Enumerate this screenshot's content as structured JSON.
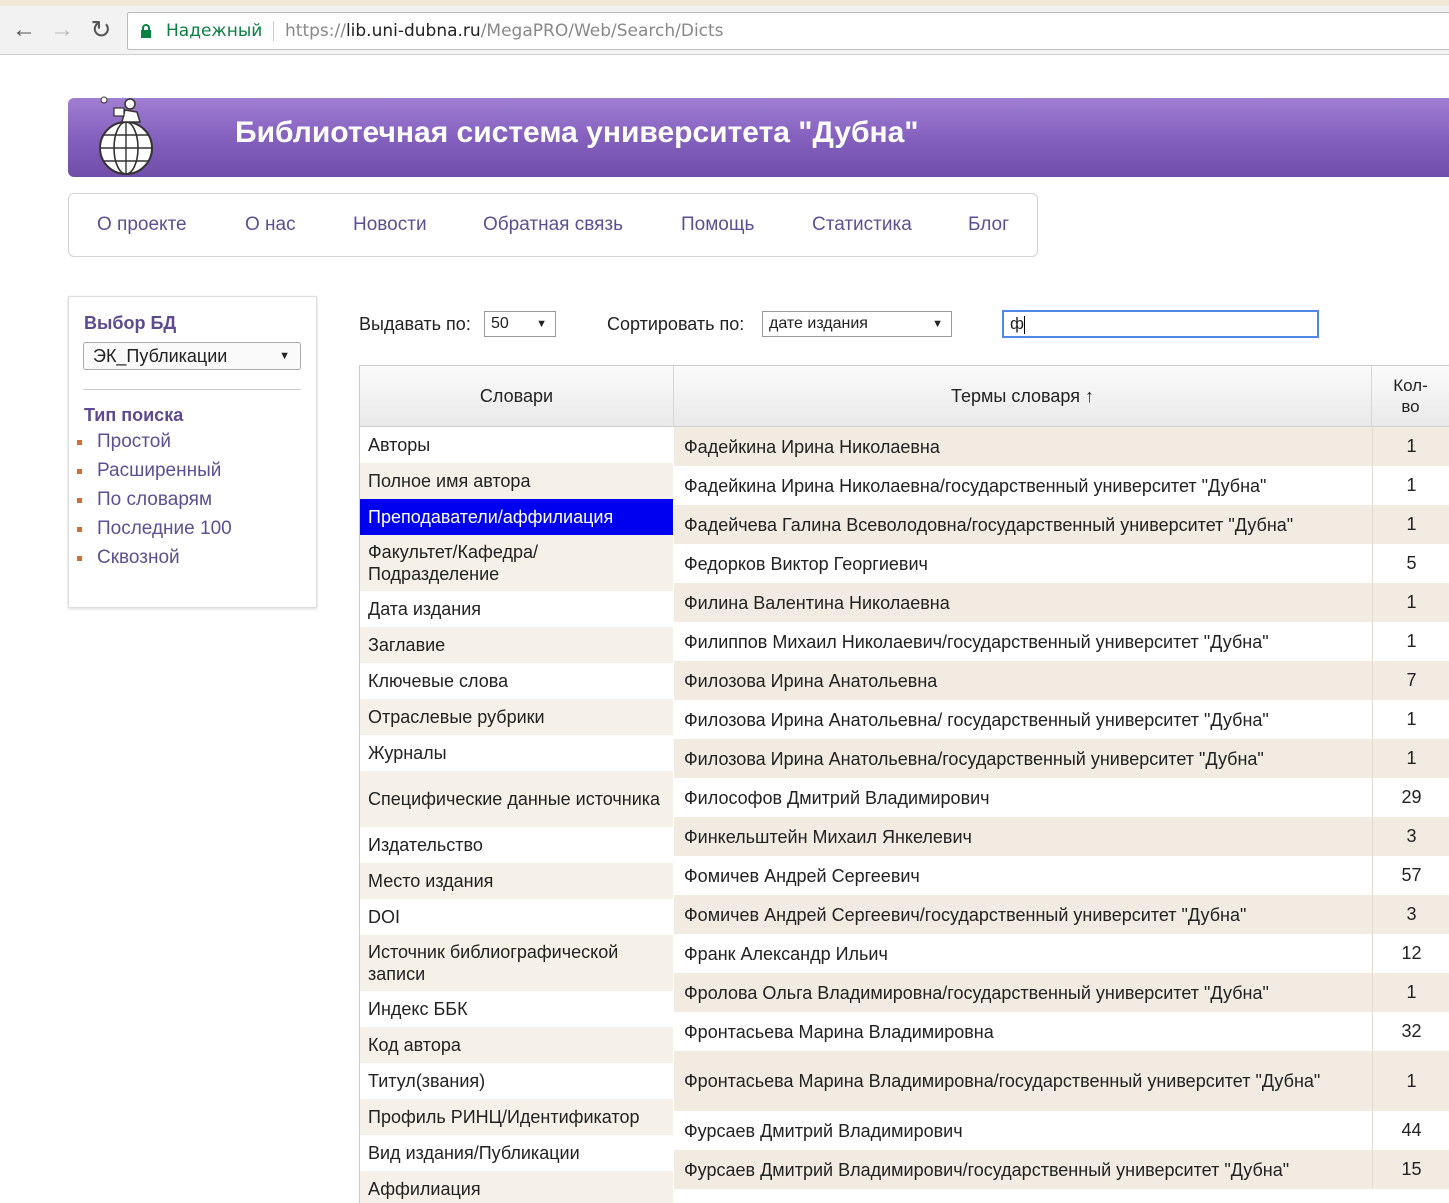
{
  "browser": {
    "secure_label": "Надежный",
    "url_scheme": "https://",
    "url_host": "lib.uni-dubna.ru",
    "url_path": "/MegaPRO/Web/Search/Dicts"
  },
  "header": {
    "title": "Библиотечная система университета \"Дубна\""
  },
  "menu": {
    "items": [
      "О проекте",
      "О нас",
      "Новости",
      "Обратная связь",
      "Помощь",
      "Статистика",
      "Блог"
    ]
  },
  "sidebar": {
    "db_title": "Выбор БД",
    "db_selected": "ЭК_Публикации",
    "search_type_title": "Тип поиска",
    "search_types": [
      "Простой",
      "Расширенный",
      "По словарям",
      "Последние 100",
      "Сквозной"
    ]
  },
  "controls": {
    "per_page_label": "Выдавать по:",
    "per_page_value": "50",
    "sort_label": "Сортировать по:",
    "sort_value": "дате издания",
    "search_value": "ф"
  },
  "grid": {
    "col_dicts": "Словари",
    "col_terms": "Термы словаря ↑",
    "col_count": "Кол-во",
    "dictionaries": [
      "Авторы",
      "Полное имя автора",
      "Преподаватели/аффилиация",
      "Факультет/Кафедра/ Подразделение",
      "Дата издания",
      "Заглавие",
      "Ключевые слова",
      "Отраслевые рубрики",
      "Журналы",
      "Специфические данные источника",
      "Издательство",
      "Место издания",
      "DOI",
      "Источник библиографической записи",
      "Индекс ББК",
      "Код автора",
      "Титул(звания)",
      "Профиль РИНЦ/Идентификатор",
      "Вид издания/Публикации",
      "Аффилиация"
    ],
    "selected_dictionary": "Преподаватели/аффилиация",
    "terms": [
      {
        "name": "Фадейкина Ирина Николаевна",
        "count": "1"
      },
      {
        "name": "Фадейкина Ирина Николаевна/государственный университет \"Дубна\"",
        "count": "1"
      },
      {
        "name": "Фадейчева Галина Всеволодовна/государственный университет \"Дубна\"",
        "count": "1"
      },
      {
        "name": "Федорков Виктор Георгиевич",
        "count": "5"
      },
      {
        "name": "Филина Валентина Николаевна",
        "count": "1"
      },
      {
        "name": "Филиппов Михаил Николаевич/государственный университет \"Дубна\"",
        "count": "1"
      },
      {
        "name": "Филозова Ирина Анатольевна",
        "count": "7"
      },
      {
        "name": "Филозова Ирина Анатольевна/ государственный университет \"Дубна\"",
        "count": "1"
      },
      {
        "name": "Филозова Ирина Анатольевна/государственный университет \"Дубна\"",
        "count": "1"
      },
      {
        "name": "Философов Дмитрий Владимирович",
        "count": "29"
      },
      {
        "name": "Финкельштейн Михаил Янкелевич",
        "count": "3"
      },
      {
        "name": "Фомичев Андрей Сергеевич",
        "count": "57"
      },
      {
        "name": "Фомичев Андрей Сергеевич/государственный университет \"Дубна\"",
        "count": "3"
      },
      {
        "name": "Франк Александр Ильич",
        "count": "12"
      },
      {
        "name": "Фролова Ольга Владимировна/государственный университет \"Дубна\"",
        "count": "1"
      },
      {
        "name": "Фронтасьева Марина Владимировна",
        "count": "32"
      },
      {
        "name": "Фронтасьева Марина Владимировна/государственный университет \"Дубна\"",
        "count": "1"
      },
      {
        "name": "Фурсаев Дмитрий Владимирович",
        "count": "44"
      },
      {
        "name": "Фурсаев Дмитрий Владимирович/государственный университет \"Дубна\"",
        "count": "15"
      }
    ]
  }
}
